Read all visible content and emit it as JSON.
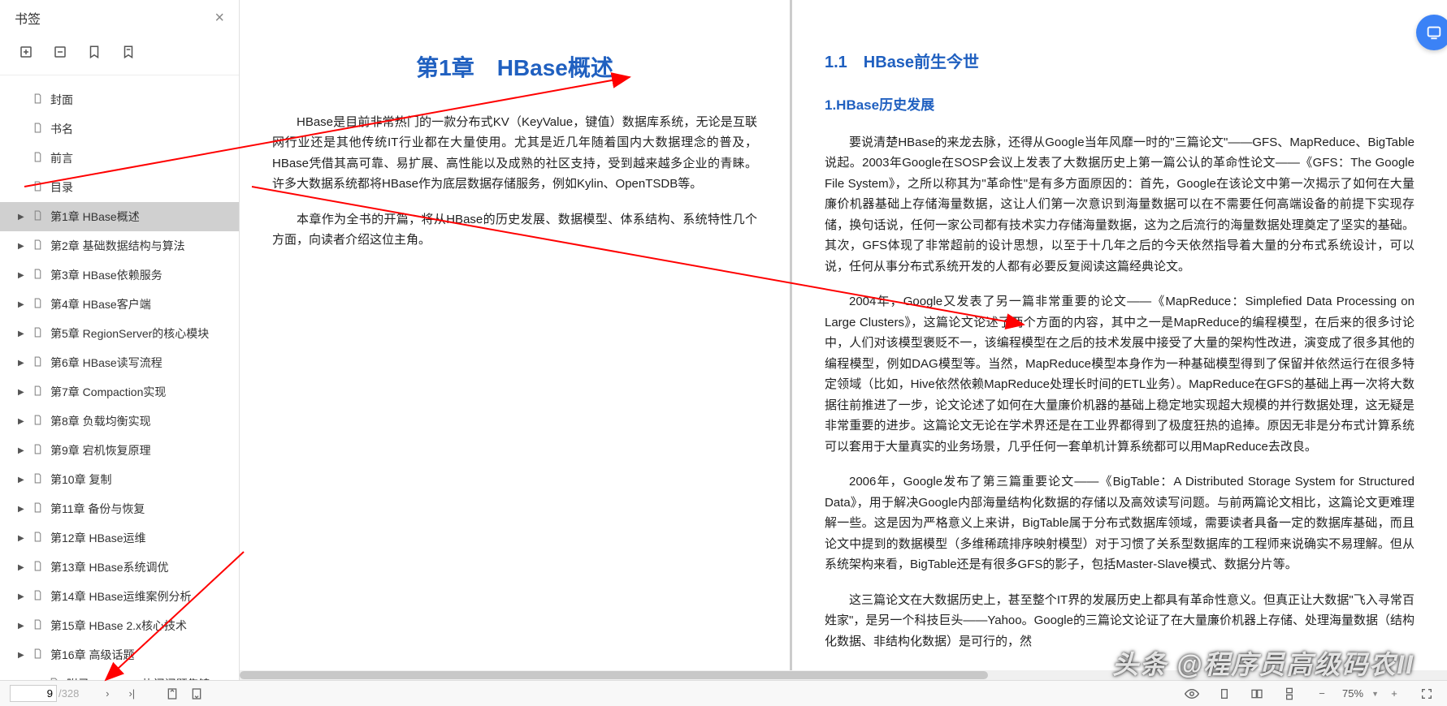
{
  "sidebar": {
    "title": "书签",
    "items": [
      {
        "label": "封面",
        "hasChildren": false
      },
      {
        "label": "书名",
        "hasChildren": false
      },
      {
        "label": "前言",
        "hasChildren": false
      },
      {
        "label": "目录",
        "hasChildren": false
      },
      {
        "label": "第1章 HBase概述",
        "hasChildren": true,
        "selected": true
      },
      {
        "label": "第2章 基础数据结构与算法",
        "hasChildren": true
      },
      {
        "label": "第3章 HBase依赖服务",
        "hasChildren": true
      },
      {
        "label": "第4章 HBase客户端",
        "hasChildren": true
      },
      {
        "label": "第5章 RegionServer的核心模块",
        "hasChildren": true
      },
      {
        "label": "第6章 HBase读写流程",
        "hasChildren": true
      },
      {
        "label": "第7章 Compaction实现",
        "hasChildren": true
      },
      {
        "label": "第8章 负载均衡实现",
        "hasChildren": true
      },
      {
        "label": "第9章 宕机恢复原理",
        "hasChildren": true
      },
      {
        "label": "第10章 复制",
        "hasChildren": true
      },
      {
        "label": "第11章 备份与恢复",
        "hasChildren": true
      },
      {
        "label": "第12章 HBase运维",
        "hasChildren": true
      },
      {
        "label": "第13章 HBase系统调优",
        "hasChildren": true
      },
      {
        "label": "第14章 HBase运维案例分析",
        "hasChildren": true
      },
      {
        "label": "第15章 HBase 2.x核心技术",
        "hasChildren": true
      },
      {
        "label": "第16章 高级话题",
        "hasChildren": true
      },
      {
        "label": "附录A　HBase热门问题集锦",
        "hasChildren": false,
        "indented": true
      }
    ]
  },
  "page_left": {
    "chapter_title": "第1章　HBase概述",
    "para1": "HBase是目前非常热门的一款分布式KV（KeyValue，键值）数据库系统，无论是互联网行业还是其他传统IT行业都在大量使用。尤其是近几年随着国内大数据理念的普及，HBase凭借其高可靠、易扩展、高性能以及成熟的社区支持，受到越来越多企业的青睐。许多大数据系统都将HBase作为底层数据存储服务，例如Kylin、OpenTSDB等。",
    "para2": "本章作为全书的开篇，将从HBase的历史发展、数据模型、体系结构、系统特性几个方面，向读者介绍这位主角。"
  },
  "page_right": {
    "section_title": "1.1　HBase前生今世",
    "subsection_title": "1.HBase历史发展",
    "para1": "要说清楚HBase的来龙去脉，还得从Google当年风靡一时的\"三篇论文\"——GFS、MapReduce、BigTable说起。2003年Google在SOSP会议上发表了大数据历史上第一篇公认的革命性论文——《GFS：The Google File System》，之所以称其为\"革命性\"是有多方面原因的：首先，Google在该论文中第一次揭示了如何在大量廉价机器基础上存储海量数据，这让人们第一次意识到海量数据可以在不需要任何高端设备的前提下实现存储，换句话说，任何一家公司都有技术实力存储海量数据，这为之后流行的海量数据处理奠定了坚实的基础。其次，GFS体现了非常超前的设计思想，以至于十几年之后的今天依然指导着大量的分布式系统设计，可以说，任何从事分布式系统开发的人都有必要反复阅读这篇经典论文。",
    "para2": "2004年，Google又发表了另一篇非常重要的论文——《MapReduce：Simplefied Data Processing on Large Clusters》，这篇论文论述了两个方面的内容，其中之一是MapReduce的编程模型，在后来的很多讨论中，人们对该模型褒贬不一，该编程模型在之后的技术发展中接受了大量的架构性改进，演变成了很多其他的编程模型，例如DAG模型等。当然，MapReduce模型本身作为一种基础模型得到了保留并依然运行在很多特定领域（比如，Hive依然依赖MapReduce处理长时间的ETL业务）。MapReduce在GFS的基础上再一次将大数据往前推进了一步，论文论述了如何在大量廉价机器的基础上稳定地实现超大规模的并行数据处理，这无疑是非常重要的进步。这篇论文无论在学术界还是在工业界都得到了极度狂热的追捧。原因无非是分布式计算系统可以套用于大量真实的业务场景，几乎任何一套单机计算系统都可以用MapReduce去改良。",
    "para3": "2006年，Google发布了第三篇重要论文——《BigTable：A Distributed Storage System for Structured Data》，用于解决Google内部海量结构化数据的存储以及高效读写问题。与前两篇论文相比，这篇论文更难理解一些。这是因为严格意义上来讲，BigTable属于分布式数据库领域，需要读者具备一定的数据库基础，而且论文中提到的数据模型（多维稀疏排序映射模型）对于习惯了关系型数据库的工程师来说确实不易理解。但从系统架构来看，BigTable还是有很多GFS的影子，包括Master-Slave模式、数据分片等。",
    "para4": "这三篇论文在大数据历史上，甚至整个IT界的发展历史上都具有革命性意义。但真正让大数据\"飞入寻常百姓家\"，是另一个科技巨头——Yahoo。Google的三篇论文论证了在大量廉价机器上存储、处理海量数据（结构化数据、非结构化数据）是可行的，然"
  },
  "footer": {
    "current_page": "9",
    "total_pages": "/328",
    "zoom": "75%"
  },
  "watermark": "头条 @程序员高级码农II"
}
